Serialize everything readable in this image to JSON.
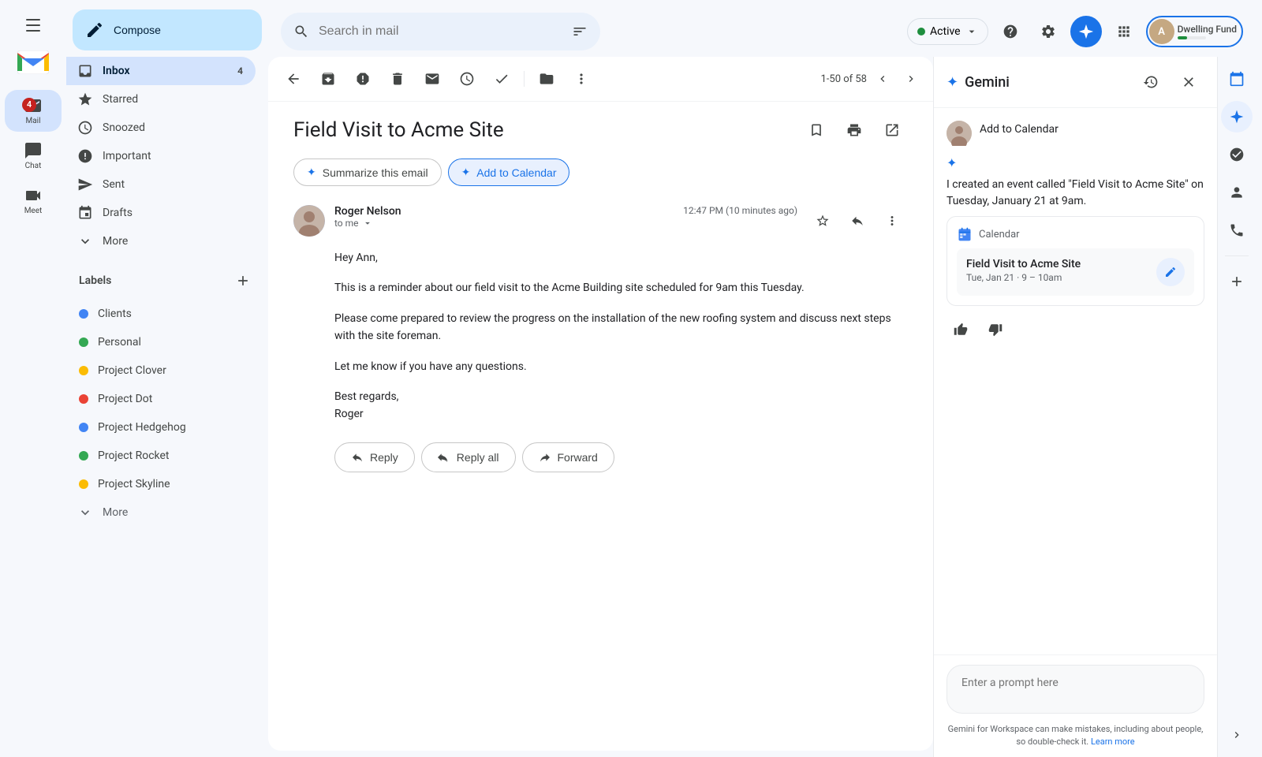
{
  "app": {
    "title": "Gmail",
    "logo_text": "Gmail"
  },
  "header": {
    "search_placeholder": "Search in mail",
    "active_status": "Active",
    "account_name": "Dwelling Fund"
  },
  "left_nav": {
    "items": [
      {
        "id": "mail",
        "label": "Mail",
        "active": true,
        "badge": 4
      },
      {
        "id": "chat",
        "label": "Chat",
        "active": false
      },
      {
        "id": "meet",
        "label": "Meet",
        "active": false
      }
    ]
  },
  "sidebar": {
    "compose_label": "Compose",
    "nav_items": [
      {
        "id": "inbox",
        "label": "Inbox",
        "active": true,
        "count": 4
      },
      {
        "id": "starred",
        "label": "Starred",
        "active": false
      },
      {
        "id": "snoozed",
        "label": "Snoozed",
        "active": false
      },
      {
        "id": "important",
        "label": "Important",
        "active": false
      },
      {
        "id": "sent",
        "label": "Sent",
        "active": false
      },
      {
        "id": "drafts",
        "label": "Drafts",
        "active": false
      },
      {
        "id": "more",
        "label": "More",
        "active": false
      }
    ],
    "labels_title": "Labels",
    "labels": [
      {
        "id": "clients",
        "label": "Clients",
        "color": "#4285f4"
      },
      {
        "id": "personal",
        "label": "Personal",
        "color": "#34a853"
      },
      {
        "id": "project-clover",
        "label": "Project Clover",
        "color": "#fbbc04"
      },
      {
        "id": "project-dot",
        "label": "Project Dot",
        "color": "#ea4335"
      },
      {
        "id": "project-hedgehog",
        "label": "Project Hedgehog",
        "color": "#4285f4"
      },
      {
        "id": "project-rocket",
        "label": "Project Rocket",
        "color": "#34a853"
      },
      {
        "id": "project-skyline",
        "label": "Project Skyline",
        "color": "#fbbc04"
      },
      {
        "id": "more-labels",
        "label": "More",
        "color": null
      }
    ]
  },
  "email_toolbar": {
    "page_info": "1-50 of 58"
  },
  "email": {
    "subject": "Field Visit to Acme Site",
    "summarize_btn": "Summarize this email",
    "add_calendar_btn": "Add to Calendar",
    "sender_name": "Roger Nelson",
    "sender_to": "to me",
    "sent_time": "12:47 PM (10 minutes ago)",
    "body_greeting": "Hey Ann,",
    "body_p1": "This is a reminder about our field visit to the Acme Building site scheduled for 9am this Tuesday.",
    "body_p2": "Please come prepared to review the progress on the installation of the new roofing system and discuss next steps with the site foreman.",
    "body_p3": "Let me know if you have any questions.",
    "body_closing": "Best regards,",
    "body_signature": "Roger",
    "reply_label": "Reply",
    "reply_all_label": "Reply all",
    "forward_label": "Forward"
  },
  "gemini": {
    "title": "Gemini",
    "close_label": "Close",
    "history_label": "History",
    "add_to_calendar_msg": "Add to Calendar",
    "response_text": "I created an event called \"Field Visit to Acme Site\" on Tuesday, January 21 at 9am.",
    "calendar_app": "Calendar",
    "event_title": "Field Visit to Acme Site",
    "event_time": "Tue, Jan 21 · 9 – 10am",
    "prompt_placeholder": "Enter a prompt here",
    "footer_text": "Gemini for Workspace can make mistakes, including about people, so double-check it.",
    "learn_more": "Learn more"
  }
}
